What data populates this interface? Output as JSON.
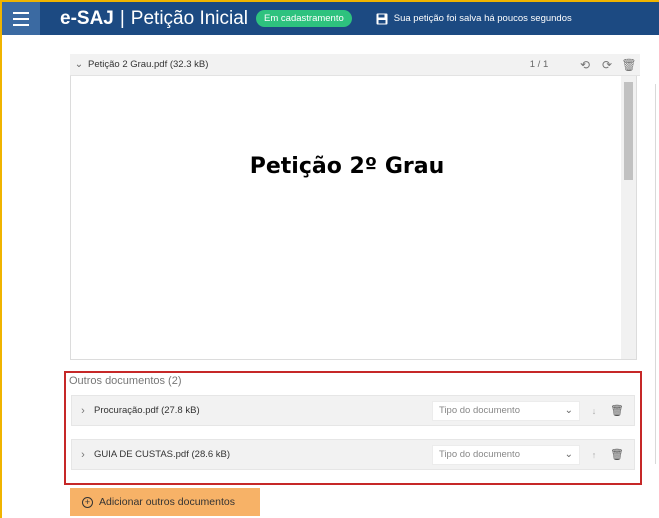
{
  "header": {
    "brand": "e-SAJ",
    "separator": "|",
    "title": "Petição Inicial",
    "status_badge": "Em cadastramento",
    "save_status": "Sua petição foi salva há poucos segundos",
    "colors": {
      "bar": "#1c4a82",
      "badge": "#2ec27e"
    }
  },
  "viewer": {
    "filename": "Petição 2 Grau.pdf (32.3 kB)",
    "pages": "1 / 1",
    "document_heading": "Petição 2º Grau",
    "icons": [
      "chevron-down-icon",
      "rotate-left-icon",
      "rotate-right-icon",
      "trash-icon"
    ]
  },
  "other_documents": {
    "title": "Outros documentos (2)",
    "highlight_color": "#c62828",
    "rows": [
      {
        "filename": "Procuração.pdf (27.8 kB)",
        "type_placeholder": "Tipo do documento",
        "arrow": "↓"
      },
      {
        "filename": "GUIA DE CUSTAS.pdf (28.6 kB)",
        "type_placeholder": "Tipo do documento",
        "arrow": "↑"
      }
    ]
  },
  "add_button": {
    "label": "Adicionar outros documentos",
    "color": "#f7b267"
  }
}
